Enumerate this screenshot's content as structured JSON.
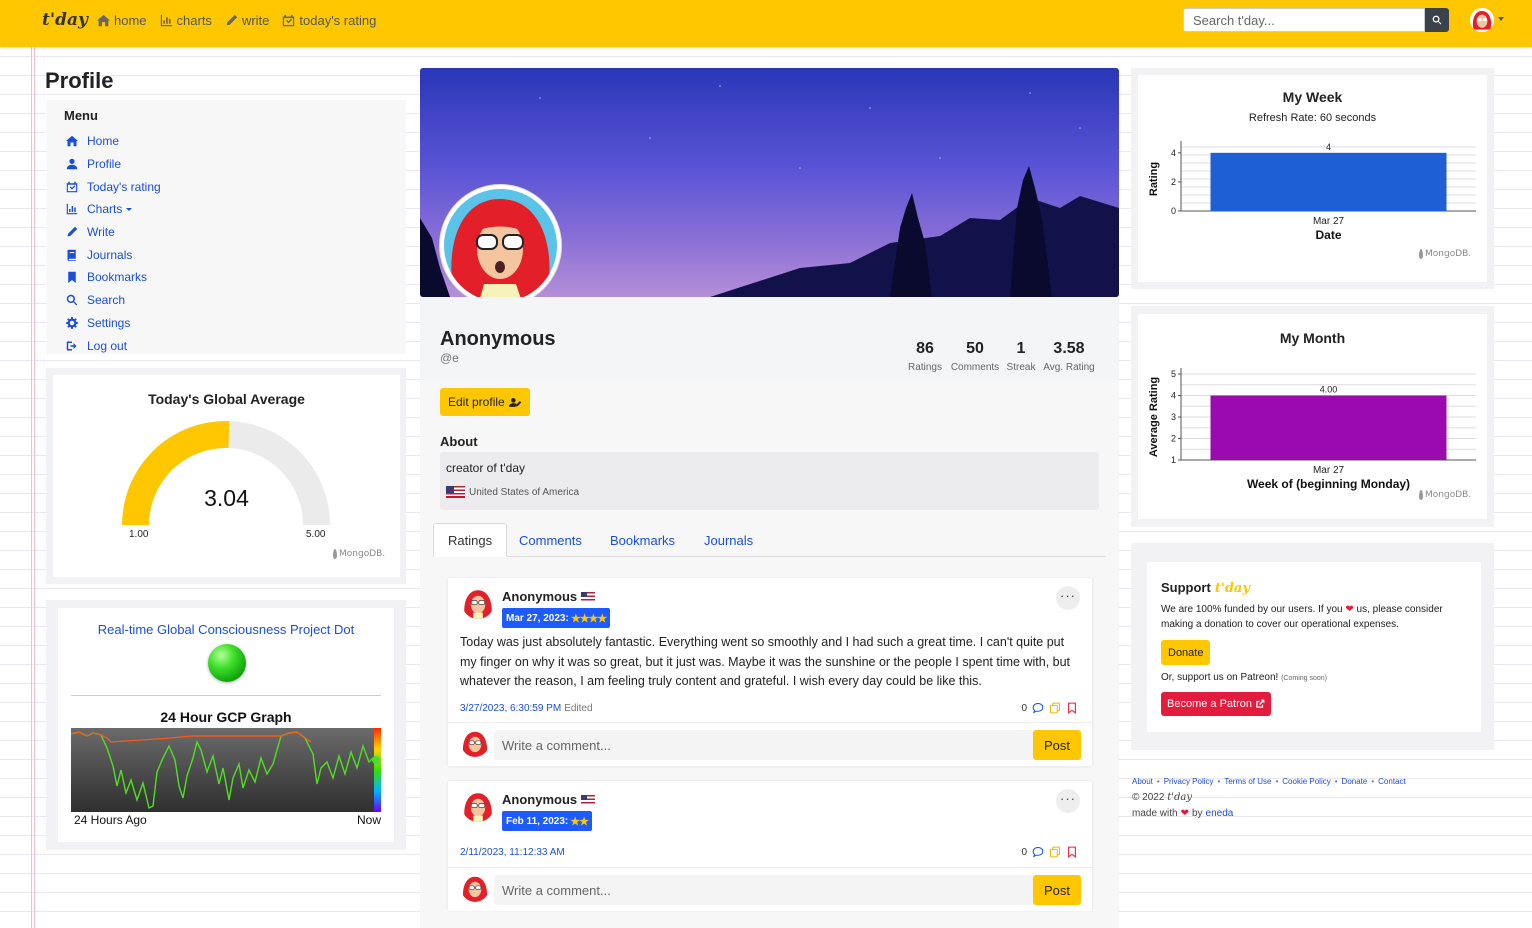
{
  "navbar": {
    "brand": "t'day",
    "links": [
      {
        "label": "home",
        "icon": "home-icon"
      },
      {
        "label": "charts",
        "icon": "bar-chart-icon"
      },
      {
        "label": "write",
        "icon": "pencil-icon"
      },
      {
        "label": "today's rating",
        "icon": "calendar-check-icon"
      }
    ],
    "search_placeholder": "Search t'day..."
  },
  "page_title": "Profile",
  "menu": {
    "title": "Menu",
    "items": [
      {
        "label": "Home",
        "icon": "home-icon"
      },
      {
        "label": "Profile",
        "icon": "user-icon"
      },
      {
        "label": "Today's rating",
        "icon": "calendar-check-icon"
      },
      {
        "label": "Charts",
        "icon": "bar-chart-icon"
      },
      {
        "label": "Write",
        "icon": "pencil-icon"
      },
      {
        "label": "Journals",
        "icon": "book-icon"
      },
      {
        "label": "Bookmarks",
        "icon": "bookmark-icon"
      },
      {
        "label": "Search",
        "icon": "search-icon"
      },
      {
        "label": "Settings",
        "icon": "gear-icon"
      },
      {
        "label": "Log out",
        "icon": "logout-icon"
      }
    ]
  },
  "global_average": {
    "title": "Today's Global Average",
    "value": "3.04",
    "min": "1.00",
    "max": "5.00",
    "fill_fraction": 0.51,
    "mongo_label": "MongoDB."
  },
  "gcp": {
    "title": "Real-time Global Consciousness Project Dot",
    "graph_title": "24 Hour GCP Graph",
    "left_label": "24 Hours Ago",
    "right_label": "Now"
  },
  "profile": {
    "name": "Anonymous",
    "handle": "@e",
    "stats": [
      {
        "value": "86",
        "label": "Ratings"
      },
      {
        "value": "50",
        "label": "Comments"
      },
      {
        "value": "1",
        "label": "Streak"
      },
      {
        "value": "3.58",
        "label": "Avg. Rating"
      }
    ],
    "edit_label": "Edit profile",
    "about_label": "About",
    "about_text": "creator of t'day",
    "country": "United States of America"
  },
  "tabs": [
    "Ratings",
    "Comments",
    "Bookmarks",
    "Journals"
  ],
  "posts": [
    {
      "author": "Anonymous",
      "date_badge": "Mar 27, 2023:",
      "stars": "★★★★",
      "text": "Today was just absolutely fantastic. Everything went so smoothly and I had such a great time. I can't quite put my finger on why it was so great, but it just was. Maybe it was the sunshine or the people I spent time with, but whatever the reason, I am feeling truly content and grateful. I wish every day could be like this.",
      "timestamp": "3/27/2023, 6:30:59 PM",
      "edited": "Edited",
      "comment_count": "0"
    },
    {
      "author": "Anonymous",
      "date_badge": "Feb 11, 2023:",
      "stars": "★★",
      "text": "",
      "timestamp": "2/11/2023, 11:12:33 AM",
      "edited": "",
      "comment_count": "0"
    }
  ],
  "comment": {
    "placeholder": "Write a comment...",
    "post_label": "Post"
  },
  "charts": {
    "week": {
      "title": "My Week",
      "subtitle": "Refresh Rate: 60 seconds",
      "mongo_label": "MongoDB."
    },
    "month": {
      "title": "My Month",
      "mongo_label": "MongoDB."
    }
  },
  "chart_data": [
    {
      "type": "bar",
      "title": "My Week",
      "subtitle": "Refresh Rate: 60 seconds",
      "categories": [
        "Mar 27"
      ],
      "values": [
        4
      ],
      "data_labels": [
        "4"
      ],
      "xlabel": "Date",
      "ylabel": "Rating",
      "yticks": [
        0,
        2,
        4
      ],
      "ylim": [
        0,
        4.4
      ],
      "color": "#1e5fd6",
      "grid": true
    },
    {
      "type": "bar",
      "title": "My Month",
      "categories": [
        "Mar 27"
      ],
      "values": [
        4.0
      ],
      "data_labels": [
        "4.00"
      ],
      "xlabel": "Week of (beginning Monday)",
      "ylabel": "Average Rating",
      "yticks": [
        1,
        2,
        3,
        4,
        5
      ],
      "ylim": [
        1,
        5
      ],
      "color": "#9b0aae",
      "grid": true
    }
  ],
  "support": {
    "title": "Support",
    "brand": "t'day",
    "text_before": "We are 100% funded by our users. If you",
    "text_after": "us, please consider making a donation to cover our operational expenses.",
    "donate_label": "Donate",
    "patreon_text": "Or, support us on Patreon!",
    "patreon_note": "(Coming soon)",
    "patron_label": "Become a Patron"
  },
  "footer": {
    "links": [
      "About",
      "Privacy Policy",
      "Terms of Use",
      "Cookie Policy",
      "Donate",
      "Contact"
    ],
    "copyright": "© 2022",
    "brand": "t'day",
    "made_with": "made with",
    "by": "by",
    "author": "eneda"
  },
  "colors": {
    "accent": "#fec700",
    "link": "#1a4fd6",
    "badge": "#1e5bff",
    "danger": "#e31b3c"
  }
}
